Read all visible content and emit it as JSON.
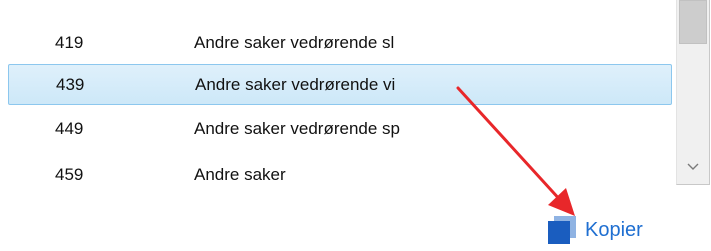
{
  "list": {
    "rows": [
      {
        "code": "419",
        "description": "Andre saker vedrørende sl",
        "selected": false
      },
      {
        "code": "439",
        "description": "Andre saker vedrørende vi",
        "selected": true
      },
      {
        "code": "449",
        "description": "Andre saker vedrørende sp",
        "selected": false
      },
      {
        "code": "459",
        "description": "Andre saker",
        "selected": false
      }
    ]
  },
  "scrollbar": {
    "down_arrow_icon": "chevron-down-icon"
  },
  "annotation": {
    "arrow_color": "#e8272a"
  },
  "actions": {
    "copy_label": "Kopier",
    "copy_icon": "copy-icon",
    "link_color": "#1f6fd1"
  }
}
